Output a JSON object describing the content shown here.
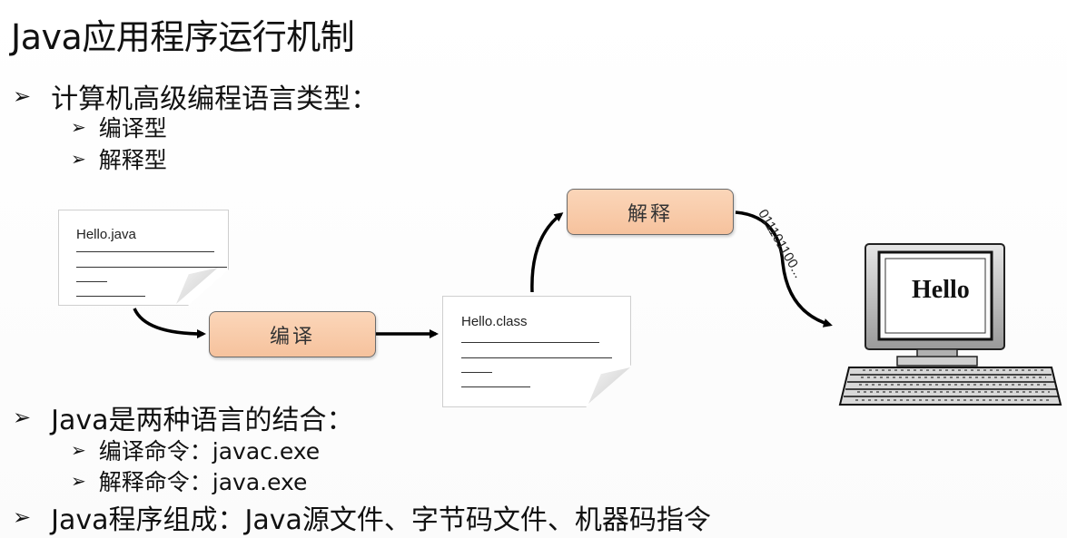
{
  "title": "Java应用程序运行机制",
  "bullets": {
    "b1": "计算机高级编程语言类型：",
    "b1_1": "编译型",
    "b1_2": "解释型",
    "b2": "Java是两种语言的结合：",
    "b2_1": "编译命令：javac.exe",
    "b2_2": "解释命令：java.exe",
    "b3": "Java程序组成：Java源文件、字节码文件、机器码指令"
  },
  "bullet_symbol": "➢",
  "diagram": {
    "source_file": "Hello.java",
    "compile_label": "编译",
    "class_file": "Hello.class",
    "interpret_label": "解释",
    "binary_text": "011101100...",
    "screen_text": "Hello"
  }
}
